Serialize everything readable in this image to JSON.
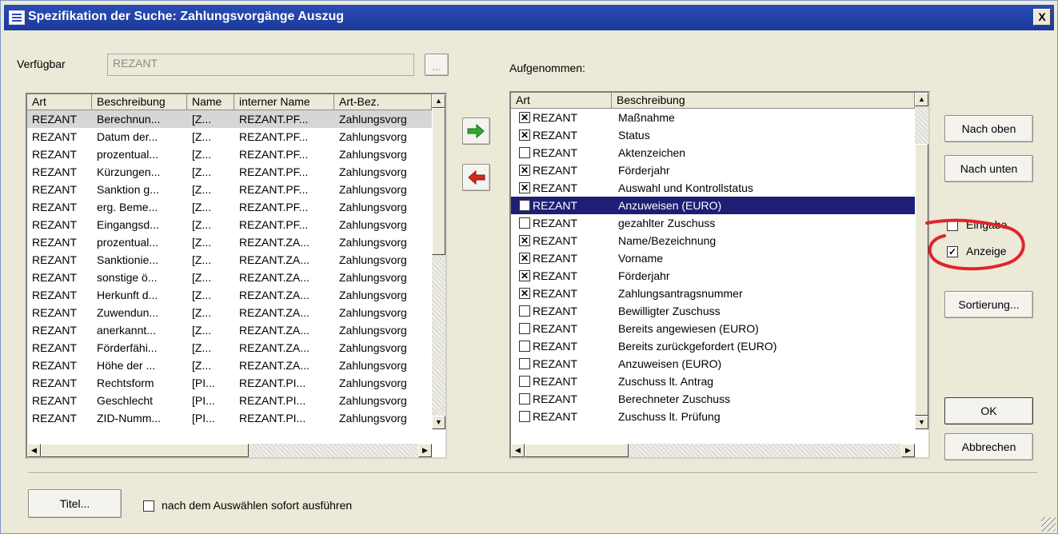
{
  "window": {
    "title": "Spezifikation der Suche: Zahlungsvorgänge Auszug",
    "close_label": "X"
  },
  "available": {
    "label": "Verfügbar",
    "filter_value": "REZANT",
    "browse_label": "...",
    "columns": [
      "Art",
      "Beschreibung",
      "Name",
      "interner Name",
      "Art-Bez."
    ],
    "rows": [
      [
        "REZANT",
        "Berechnun...",
        "[Z...",
        "REZANT.PF...",
        "Zahlungsvorg"
      ],
      [
        "REZANT",
        "Datum der...",
        "[Z...",
        "REZANT.PF...",
        "Zahlungsvorg"
      ],
      [
        "REZANT",
        "prozentual...",
        "[Z...",
        "REZANT.PF...",
        "Zahlungsvorg"
      ],
      [
        "REZANT",
        "Kürzungen...",
        "[Z...",
        "REZANT.PF...",
        "Zahlungsvorg"
      ],
      [
        "REZANT",
        "Sanktion g...",
        "[Z...",
        "REZANT.PF...",
        "Zahlungsvorg"
      ],
      [
        "REZANT",
        "erg. Beme...",
        "[Z...",
        "REZANT.PF...",
        "Zahlungsvorg"
      ],
      [
        "REZANT",
        "Eingangsd...",
        "[Z...",
        "REZANT.PF...",
        "Zahlungsvorg"
      ],
      [
        "REZANT",
        "prozentual...",
        "[Z...",
        "REZANT.ZA...",
        "Zahlungsvorg"
      ],
      [
        "REZANT",
        "Sanktionie...",
        "[Z...",
        "REZANT.ZA...",
        "Zahlungsvorg"
      ],
      [
        "REZANT",
        "sonstige ö...",
        "[Z...",
        "REZANT.ZA...",
        "Zahlungsvorg"
      ],
      [
        "REZANT",
        "Herkunft d...",
        "[Z...",
        "REZANT.ZA...",
        "Zahlungsvorg"
      ],
      [
        "REZANT",
        "Zuwendun...",
        "[Z...",
        "REZANT.ZA...",
        "Zahlungsvorg"
      ],
      [
        "REZANT",
        "anerkannt...",
        "[Z...",
        "REZANT.ZA...",
        "Zahlungsvorg"
      ],
      [
        "REZANT",
        "Förderfähi...",
        "[Z...",
        "REZANT.ZA...",
        "Zahlungsvorg"
      ],
      [
        "REZANT",
        "Höhe der ...",
        "[Z...",
        "REZANT.ZA...",
        "Zahlungsvorg"
      ],
      [
        "REZANT",
        "Rechtsform",
        "[PI...",
        "REZANT.PI...",
        "Zahlungsvorg"
      ],
      [
        "REZANT",
        "Geschlecht",
        "[PI...",
        "REZANT.PI...",
        "Zahlungsvorg"
      ],
      [
        "REZANT",
        "ZID-Numm...",
        "[PI...",
        "REZANT.PI...",
        "Zahlungsvorg"
      ]
    ]
  },
  "selected": {
    "label": "Aufgenommen:",
    "columns": [
      "Art",
      "Beschreibung"
    ],
    "rows": [
      {
        "checked": true,
        "art": "REZANT",
        "desc": "Maßnahme"
      },
      {
        "checked": true,
        "art": "REZANT",
        "desc": "Status"
      },
      {
        "checked": false,
        "art": "REZANT",
        "desc": "Aktenzeichen"
      },
      {
        "checked": true,
        "art": "REZANT",
        "desc": "Förderjahr"
      },
      {
        "checked": true,
        "art": "REZANT",
        "desc": "Auswahl und Kontrollstatus"
      },
      {
        "checked": false,
        "art": "REZANT",
        "desc": "Anzuweisen (EURO)"
      },
      {
        "checked": false,
        "art": "REZANT",
        "desc": "gezahlter Zuschuss"
      },
      {
        "checked": true,
        "art": "REZANT",
        "desc": "Name/Bezeichnung"
      },
      {
        "checked": true,
        "art": "REZANT",
        "desc": "Vorname"
      },
      {
        "checked": true,
        "art": "REZANT",
        "desc": "Förderjahr"
      },
      {
        "checked": true,
        "art": "REZANT",
        "desc": "Zahlungsantragsnummer"
      },
      {
        "checked": false,
        "art": "REZANT",
        "desc": "Bewilligter Zuschuss"
      },
      {
        "checked": false,
        "art": "REZANT",
        "desc": "Bereits angewiesen (EURO)"
      },
      {
        "checked": false,
        "art": "REZANT",
        "desc": "Bereits zurückgefordert (EURO)"
      },
      {
        "checked": false,
        "art": "REZANT",
        "desc": "Anzuweisen (EURO)"
      },
      {
        "checked": false,
        "art": "REZANT",
        "desc": "Zuschuss lt. Antrag"
      },
      {
        "checked": false,
        "art": "REZANT",
        "desc": "Berechneter Zuschuss"
      },
      {
        "checked": false,
        "art": "REZANT",
        "desc": "Zuschuss lt. Prüfung"
      }
    ]
  },
  "side": {
    "up": "Nach oben",
    "down": "Nach unten",
    "eingabe": "Eingabe",
    "eingabe_checked": false,
    "anzeige": "Anzeige",
    "anzeige_checked": true,
    "sort": "Sortierung...",
    "ok": "OK",
    "cancel": "Abbrechen"
  },
  "footer": {
    "title_button": "Titel...",
    "run_label": "nach dem Auswählen sofort ausführen",
    "run_checked": false
  },
  "colors": {
    "titlebar": "#1b3a9a",
    "selection": "#1e1f74",
    "annotation": "#e0242a",
    "add_arrow": "#2fa82f",
    "remove_arrow": "#d02a20"
  }
}
